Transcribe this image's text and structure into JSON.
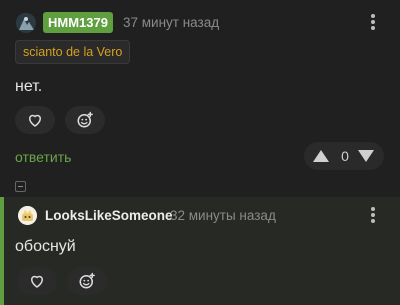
{
  "comment1": {
    "username": "HMM1379",
    "time": "37 минут назад",
    "tag": "scianto de la Vero",
    "text": "нет.",
    "reply_label": "ответить",
    "vote_count": "0"
  },
  "comment2": {
    "username": "LooksLikeSomeone",
    "time": "32 минуты назад",
    "text": "обоснуй"
  },
  "colors": {
    "background": "#202020",
    "accent_green": "#5f9f3f",
    "tag_gold": "#d6a020",
    "muted": "#8a8a8a"
  },
  "icons": [
    "user-avatar-icon",
    "kebab-menu-icon",
    "heart-icon",
    "add-reaction-icon",
    "upvote-icon",
    "downvote-icon",
    "collapse-icon"
  ]
}
